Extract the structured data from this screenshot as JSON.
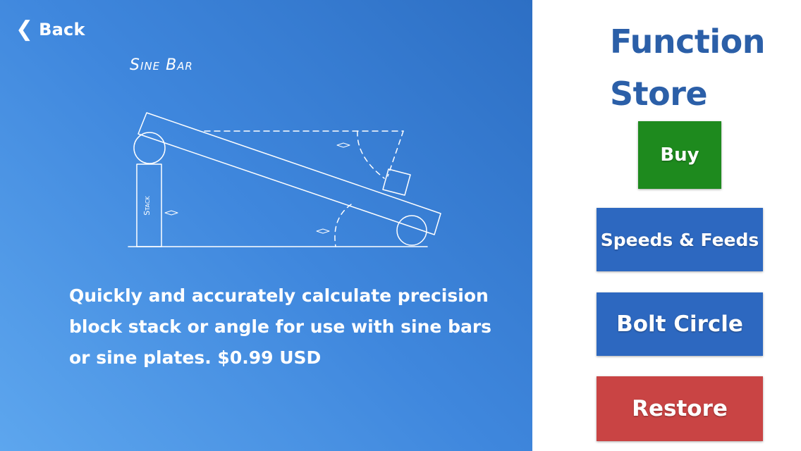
{
  "back": {
    "label": "Back",
    "icon": "chevron-left-icon"
  },
  "diagram": {
    "title": "Sine Bar",
    "stack_label": "Stack"
  },
  "description": "Quickly and accurately calculate precision block stack or angle for use with sine bars or sine plates. $0.99 USD",
  "store": {
    "title_line1": "Function",
    "title_line2": "Store"
  },
  "buttons": {
    "buy": "Buy",
    "speeds_feeds": "Speeds & Feeds",
    "bolt_circle": "Bolt Circle",
    "restore": "Restore"
  },
  "colors": {
    "panel_gradient_start": "#5da6ee",
    "panel_gradient_end": "#2d6fc4",
    "title_blue": "#2b5fa8",
    "buy_green": "#1e8a1e",
    "nav_blue": "#2d68c0",
    "restore_red": "#c94444"
  }
}
